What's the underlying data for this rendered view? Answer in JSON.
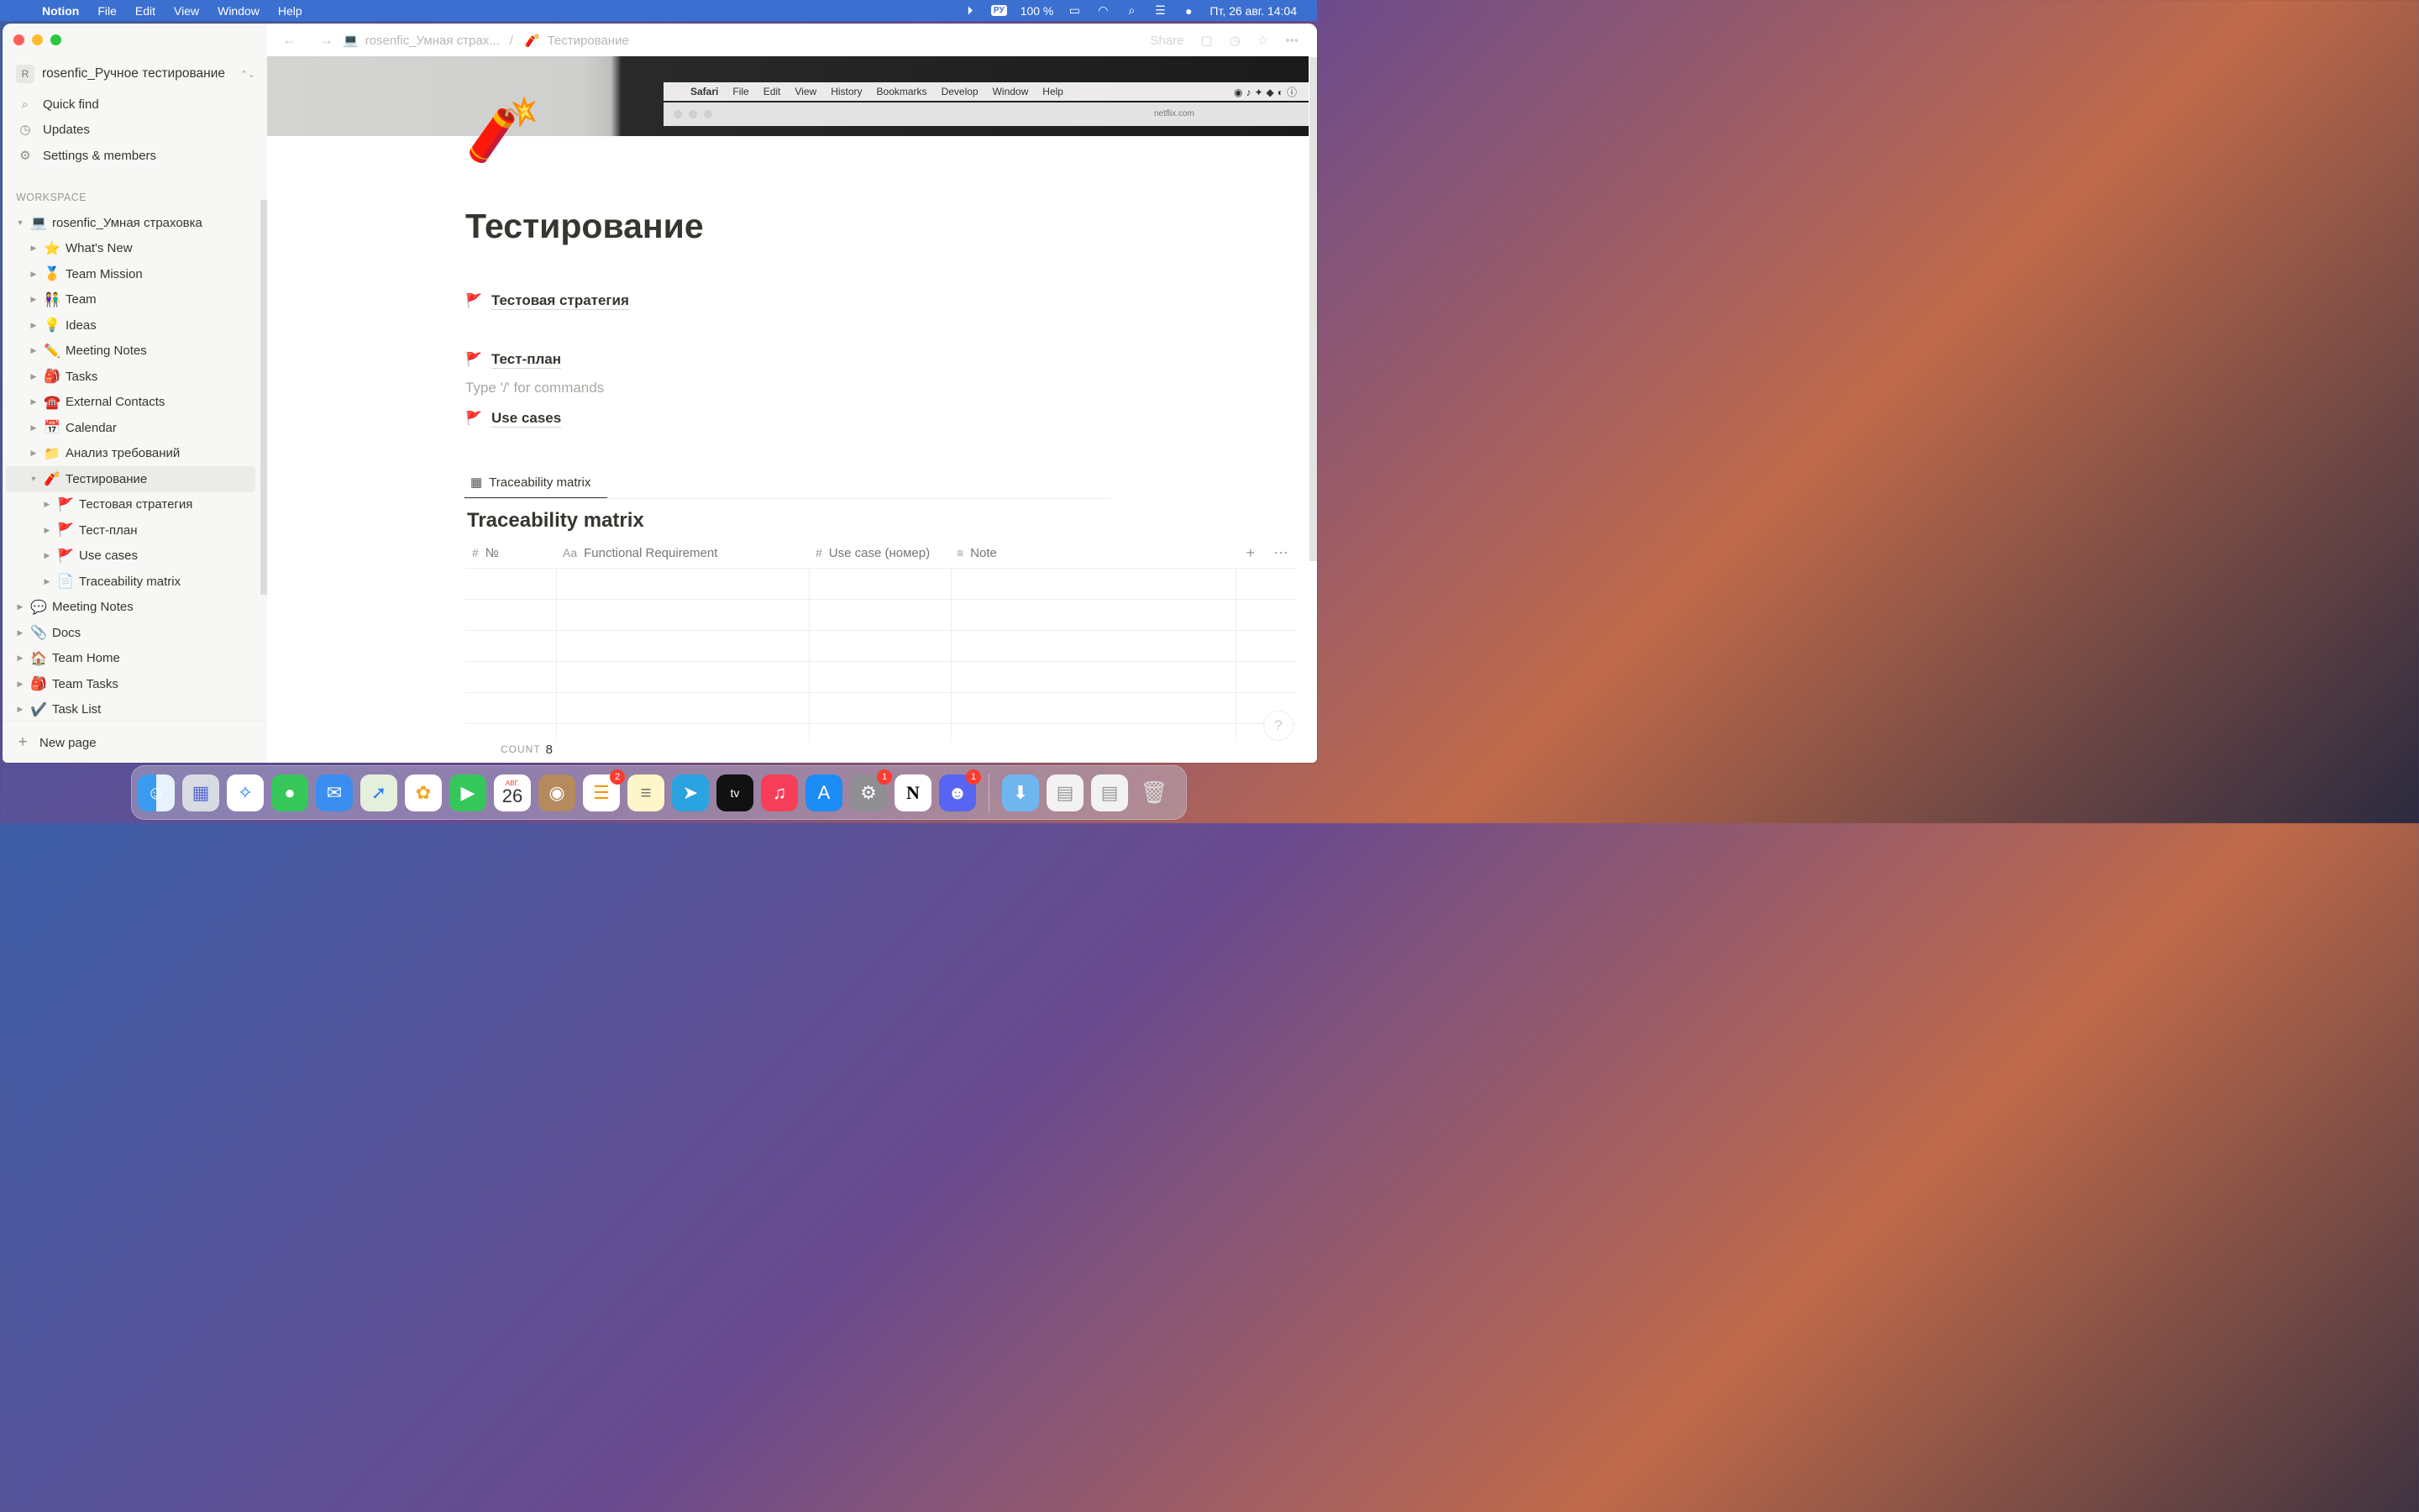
{
  "menubar": {
    "app_name": "Notion",
    "menus": [
      "File",
      "Edit",
      "View",
      "Window",
      "Help"
    ],
    "input_source": "РУ",
    "battery": "100 %",
    "datetime": "Пт, 26 авг.  14:04"
  },
  "sidebar": {
    "workspace_initial": "R",
    "workspace_name": "rosenfic_Ручное тестирование",
    "actions": {
      "quick_find": "Quick find",
      "updates": "Updates",
      "settings": "Settings & members"
    },
    "section_label": "WORKSPACE",
    "tree": [
      {
        "emoji": "💻",
        "label": "rosenfic_Умная страховка",
        "expanded": true
      },
      {
        "emoji": "⭐",
        "label": "What's New"
      },
      {
        "emoji": "🥇",
        "label": "Team Mission"
      },
      {
        "emoji": "👫",
        "label": "Team"
      },
      {
        "emoji": "💡",
        "label": "Ideas"
      },
      {
        "emoji": "✏️",
        "label": "Meeting Notes"
      },
      {
        "emoji": "🎒",
        "label": "Tasks"
      },
      {
        "emoji": "☎️",
        "label": "External Contacts"
      },
      {
        "emoji": "📅",
        "label": "Calendar"
      },
      {
        "emoji": "📁",
        "label": "Анализ требований"
      },
      {
        "emoji": "🧨",
        "label": "Тестирование",
        "expanded": true,
        "selected": true
      },
      {
        "emoji": "🚩",
        "label": "Тестовая стратегия"
      },
      {
        "emoji": "🚩",
        "label": "Тест-план"
      },
      {
        "emoji": "🚩",
        "label": "Use cases"
      },
      {
        "emoji": "📄",
        "label": "Traceability matrix"
      },
      {
        "emoji": "💬",
        "label": "Meeting Notes"
      },
      {
        "emoji": "📎",
        "label": "Docs"
      },
      {
        "emoji": "🏠",
        "label": "Team Home"
      },
      {
        "emoji": "🎒",
        "label": "Team Tasks"
      },
      {
        "emoji": "✔️",
        "label": "Task List"
      }
    ],
    "new_page": "New page"
  },
  "topbar": {
    "breadcrumb": [
      {
        "emoji": "💻",
        "label": "rosenfic_Умная страх..."
      },
      {
        "emoji": "🧨",
        "label": "Тестирование"
      }
    ],
    "share": "Share"
  },
  "cover": {
    "safari_menus": [
      "Safari",
      "File",
      "Edit",
      "View",
      "History",
      "Bookmarks",
      "Develop",
      "Window",
      "Help"
    ],
    "url": "netflix.com"
  },
  "page": {
    "icon": "🧨",
    "title": "Тестирование",
    "links": [
      {
        "emoji": "🚩",
        "label": "Тестовая стратегия"
      },
      {
        "emoji": "🚩",
        "label": "Тест-план"
      },
      {
        "emoji": "🚩",
        "label": "Use cases"
      }
    ],
    "placeholder": "Type '/' for commands"
  },
  "database": {
    "view_tab": "Traceability matrix",
    "title": "Traceability matrix",
    "columns": [
      {
        "icon": "#",
        "label": "№"
      },
      {
        "icon": "Aa",
        "label": "Functional Requirement"
      },
      {
        "icon": "#",
        "label": "Use case (номер)"
      },
      {
        "icon": "≡",
        "label": "Note"
      }
    ],
    "visible_rows": 6,
    "count_label": "COUNT",
    "count_value": "8"
  },
  "dock": {
    "apps": [
      "finder",
      "launchpad",
      "safari",
      "messages",
      "mail",
      "maps",
      "photos",
      "facetime",
      "calendar",
      "contacts",
      "reminders",
      "notes",
      "telegram",
      "tv",
      "music",
      "app-store",
      "system-preferences",
      "notion",
      "discord"
    ],
    "calendar_month": "АВГ.",
    "calendar_day": "26",
    "badges": {
      "reminders": "2",
      "system-preferences": "1",
      "discord": "1"
    }
  }
}
